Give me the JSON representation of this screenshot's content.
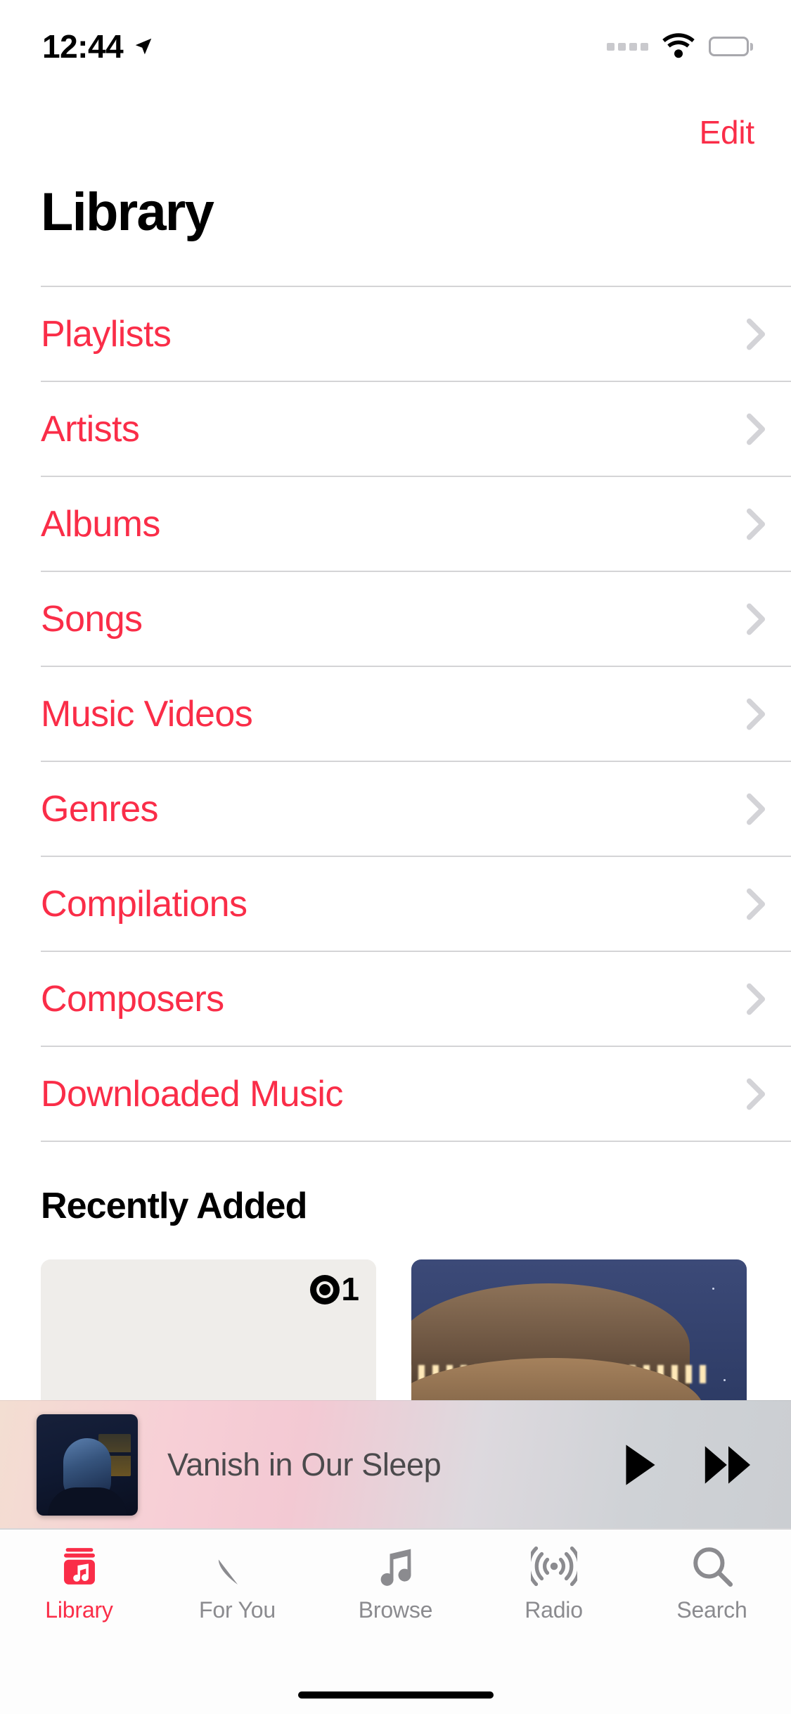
{
  "status_bar": {
    "time": "12:44",
    "location_icon": "location-arrow-icon",
    "signal_icon": "signal-dots-icon",
    "wifi_icon": "wifi-icon",
    "battery_icon": "battery-full-icon"
  },
  "nav": {
    "edit_label": "Edit"
  },
  "page": {
    "title": "Library"
  },
  "library_rows": [
    {
      "label": "Playlists"
    },
    {
      "label": "Artists"
    },
    {
      "label": "Albums"
    },
    {
      "label": "Songs"
    },
    {
      "label": "Music Videos"
    },
    {
      "label": "Genres"
    },
    {
      "label": "Compilations"
    },
    {
      "label": "Composers"
    },
    {
      "label": "Downloaded Music"
    }
  ],
  "recently_added": {
    "heading": "Recently Added",
    "tiles": [
      {
        "name": "beats-1-radio-artwork",
        "badge": "b1",
        "badge_one": "1"
      },
      {
        "name": "carousel-night-album-artwork"
      }
    ]
  },
  "mini_player": {
    "track_title": "Vanish in Our Sleep",
    "artwork_name": "now-playing-artwork",
    "play_icon": "play-icon",
    "forward_icon": "fast-forward-icon"
  },
  "tab_bar": {
    "tabs": [
      {
        "label": "Library",
        "icon": "library-icon",
        "active": true
      },
      {
        "label": "For You",
        "icon": "heart-icon",
        "active": false
      },
      {
        "label": "Browse",
        "icon": "music-note-icon",
        "active": false
      },
      {
        "label": "Radio",
        "icon": "radio-waves-icon",
        "active": false
      },
      {
        "label": "Search",
        "icon": "search-icon",
        "active": false
      }
    ]
  },
  "colors": {
    "accent": "#FA2D48",
    "inactive": "#8b8b8f",
    "divider": "#d4d4d6",
    "text": "#000000"
  }
}
